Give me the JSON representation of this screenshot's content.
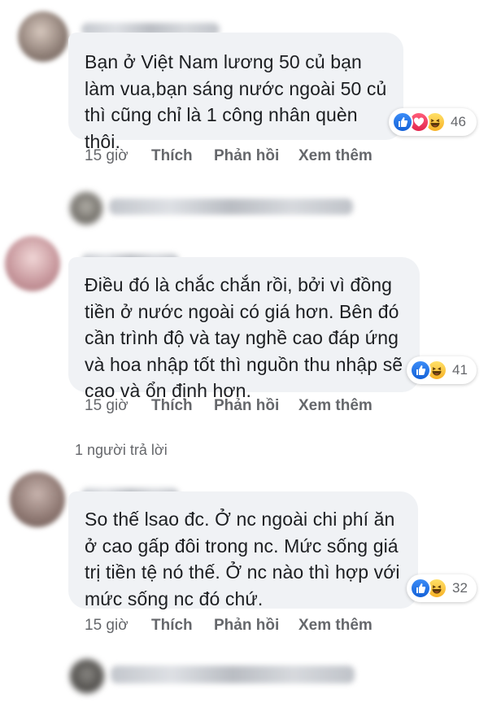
{
  "comments": [
    {
      "text": [
        "Bạn ở Việt Nam lương 50 củ bạn",
        "làm vua,bạn sáng nước ngoài 50 củ",
        "thì cũng chỉ là 1 công nhân quèn",
        "thôi."
      ],
      "reactions": [
        "like-icon",
        "love-icon",
        "haha-icon"
      ],
      "reaction_count": "46",
      "time": "15 giờ",
      "like_label": "Thích",
      "reply_label": "Phản hồi",
      "more_label": "Xem thêm"
    },
    {
      "text": [
        "Điều đó là chắc chắn rồi, bởi vì đồng",
        "tiền ở nước ngoài có giá hơn. Bên đó",
        "cần trình độ và tay nghề cao đáp ứng",
        "và hoa nhập tốt thì nguồn thu nhập sẽ",
        "cao và ổn định hơn."
      ],
      "reactions": [
        "like-icon",
        "haha-icon"
      ],
      "reaction_count": "41",
      "time": "15 giờ",
      "like_label": "Thích",
      "reply_label": "Phản hồi",
      "more_label": "Xem thêm"
    },
    {
      "text": [
        "So thế lsao đc. Ở nc ngoài chi phí ăn",
        "ở cao gấp đôi trong nc. Mức sống giá",
        "trị tiền tệ nó thế. Ở nc nào thì hợp với",
        "mức sống nc đó chứ."
      ],
      "reactions": [
        "like-icon",
        "haha-icon"
      ],
      "reaction_count": "32",
      "time": "15 giờ",
      "like_label": "Thích",
      "reply_label": "Phản hồi",
      "more_label": "Xem thêm"
    }
  ],
  "reply_summary": "1 người trả lời",
  "colors": {
    "bubble": "#f0f2f5",
    "meta_text": "#65676b",
    "like_blue": "#1877f2",
    "love_red": "#e2264d",
    "haha_yellow": "#f7b125"
  }
}
